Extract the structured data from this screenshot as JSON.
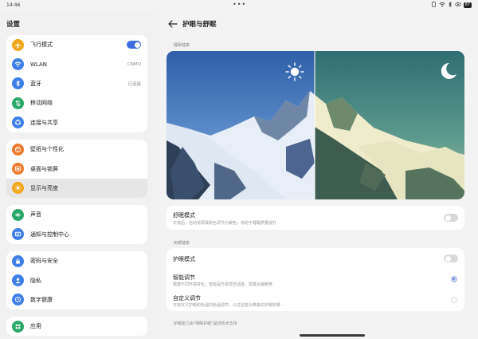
{
  "status": {
    "time": "14:46",
    "battery": "87"
  },
  "left": {
    "title": "设置",
    "groups": [
      [
        {
          "label": "飞行模式",
          "icon": "airplane-icon",
          "color": "#f2a71b",
          "control": "toggle-on"
        },
        {
          "label": "WLAN",
          "icon": "wifi-icon",
          "color": "#3f7fe8",
          "value": "CNMO"
        },
        {
          "label": "蓝牙",
          "icon": "bluetooth-icon",
          "color": "#3f7fe8",
          "value": "已连接"
        },
        {
          "label": "移动网络",
          "icon": "mobile-network-icon",
          "color": "#2aa86a"
        },
        {
          "label": "连接与共享",
          "icon": "connection-share-icon",
          "color": "#3f7fe8"
        }
      ],
      [
        {
          "label": "壁纸与个性化",
          "icon": "wallpaper-icon",
          "color": "#ef7a2b"
        },
        {
          "label": "桌面与锁屏",
          "icon": "desktop-lockscreen-icon",
          "color": "#ef7a2b"
        },
        {
          "label": "显示与亮度",
          "icon": "display-brightness-icon",
          "color": "#f2a71b",
          "active": true
        }
      ],
      [
        {
          "label": "声音",
          "icon": "sound-icon",
          "color": "#2aa86a"
        },
        {
          "label": "通知与控制中心",
          "icon": "notification-icon",
          "color": "#3f7fe8"
        }
      ],
      [
        {
          "label": "密码与安全",
          "icon": "lock-icon",
          "color": "#3f7fe8"
        },
        {
          "label": "隐私",
          "icon": "privacy-icon",
          "color": "#3f7fe8"
        },
        {
          "label": "数字健康",
          "icon": "digital-health-icon",
          "color": "#3f7fe8"
        }
      ],
      [
        {
          "label": "应用",
          "icon": "apps-icon",
          "color": "#2aa86a"
        }
      ]
    ]
  },
  "right": {
    "title": "护眼与舒眠",
    "section1": "睡眠健康",
    "sleep_mode": {
      "title": "舒眠模式",
      "subtitle": "日落后，自动将屏幕颜色调节为暖色，有助于睡眠质量提升"
    },
    "section2": "用眼健康",
    "eye_care": {
      "title": "护眼模式"
    },
    "smart": {
      "title": "智能调节",
      "subtitle": "根据不同环境变化，智能提升视觉舒适度，屏幕会偏暖黄"
    },
    "custom": {
      "title": "自定义调节",
      "subtitle": "可自定义护眼和色温的色温调节，以过滤蓝光带来的护眼效果"
    },
    "footer": "护眼能力由\"明眸护眼\"提供技术支持"
  }
}
